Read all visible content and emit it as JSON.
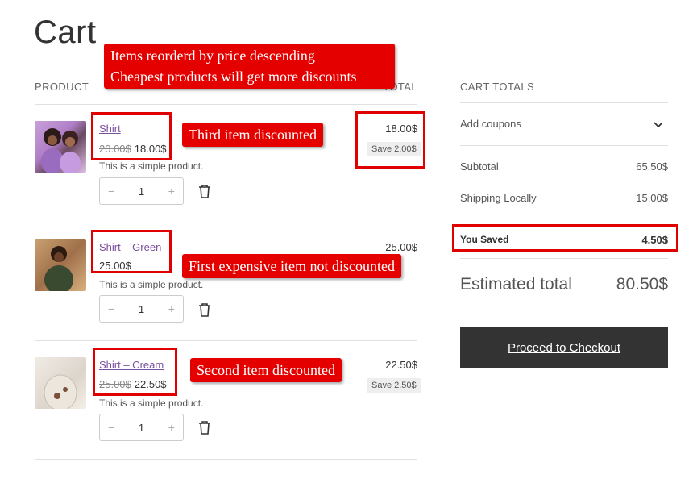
{
  "page": {
    "title": "Cart"
  },
  "table": {
    "col_product": "PRODUCT",
    "col_total": "TOTAL"
  },
  "items": [
    {
      "name": "Shirt",
      "old_price": "20.00$",
      "price": "18.00$",
      "description": "This is a simple product.",
      "qty": "1",
      "total": "18.00$",
      "save": "Save 2.00$"
    },
    {
      "name": "Shirt – Green",
      "old_price": "",
      "price": "25.00$",
      "description": "This is a simple product.",
      "qty": "1",
      "total": "25.00$",
      "save": ""
    },
    {
      "name": "Shirt – Cream",
      "old_price": "25.00$",
      "price": "22.50$",
      "description": "This is a simple product.",
      "qty": "1",
      "total": "22.50$",
      "save": "Save 2.50$"
    }
  ],
  "qty_controls": {
    "minus": "−",
    "plus": "+"
  },
  "totals": {
    "heading": "CART TOTALS",
    "coupons": "Add coupons",
    "subtotal_label": "Subtotal",
    "subtotal": "65.50$",
    "shipping_label": "Shipping Locally",
    "shipping": "15.00$",
    "saved_label": "You Saved",
    "saved": "4.50$",
    "estimated_label": "Estimated total",
    "estimated": "80.50$",
    "checkout": "Proceed to Checkout"
  },
  "annotations": {
    "reorder_line1": "Items reorderd by price descending",
    "reorder_line2": "Cheapest products will get more discounts",
    "third": "Third item discounted",
    "first": "First expensive item not discounted",
    "second": "Second item discounted"
  },
  "colors": {
    "accent": "#e50000",
    "link": "#7b4fa0",
    "button": "#333333"
  }
}
